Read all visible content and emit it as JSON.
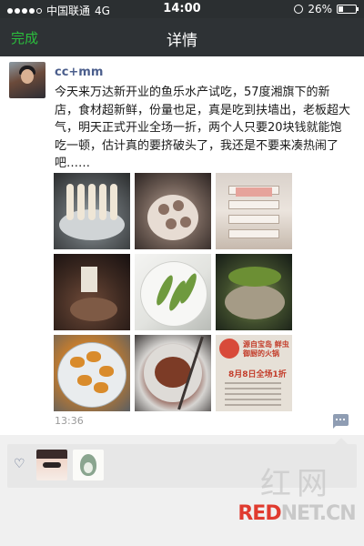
{
  "status_bar": {
    "carrier": "中国联通",
    "network": "4G",
    "time": "14:00",
    "battery": "26%",
    "battery_level": 0.26,
    "signal_bars": "4 of 5"
  },
  "nav": {
    "back_label": "完成",
    "title": "详情"
  },
  "post": {
    "username": "cc+mm",
    "text": "今天来万达新开业的鱼乐水产试吃，57度湘旗下的新店，食材超新鲜，份量也足，真是吃到扶墙出，老板超大气，明天正式开业全场一折，两个人只要20块钱就能饱吃一顿，估计真的要挤破头了，我还是不要来凑热闹了吧……",
    "timestamp": "13:36",
    "photos": [
      {
        "subject": "skewers in steaming bowl"
      },
      {
        "subject": "meatballs and vegetables"
      },
      {
        "subject": "stacked white serving tower"
      },
      {
        "subject": "drinks and hot pot"
      },
      {
        "subject": "plate with herbs"
      },
      {
        "subject": "hot pot with greens"
      },
      {
        "subject": "fried fish pieces"
      },
      {
        "subject": "dipping sauce bowl"
      },
      {
        "subject": "promotion sign"
      }
    ],
    "promo_sign": {
      "headline": "源自宝岛 鲜虫御厨的火锅",
      "offer": "8月8日全场1折"
    }
  },
  "likes": {
    "icon": "heart-icon",
    "count_avatars": 2
  },
  "watermark": {
    "cn": "红网",
    "en_red": "RED",
    "en_rest": "NET.CN"
  },
  "colors": {
    "accent_green": "#2bbd3d",
    "nav_bg": "#2e3235",
    "username_blue": "#4b5e8c",
    "comment_button": "#8f9db3"
  }
}
